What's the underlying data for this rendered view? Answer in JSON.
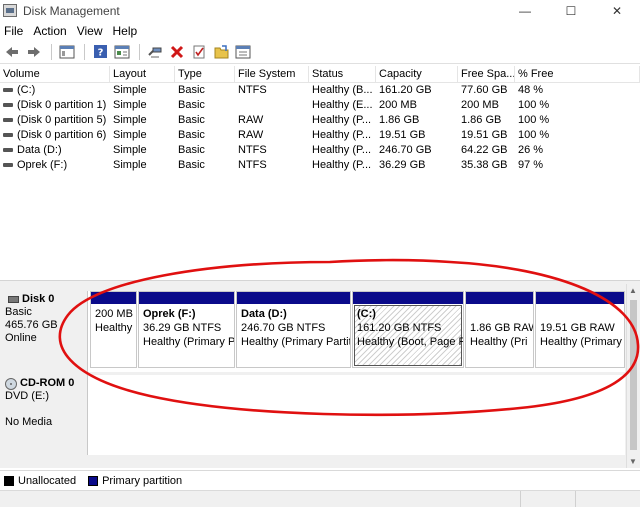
{
  "window": {
    "title": "Disk Management",
    "minimize": "—",
    "maximize": "☐",
    "close": "✕"
  },
  "menu": [
    "File",
    "Action",
    "View",
    "Help"
  ],
  "toolbar": {
    "icons": [
      "back-icon",
      "forward-icon",
      "console-tree-icon",
      "help-icon",
      "properties-icon",
      "connect-icon",
      "delete-icon",
      "check-icon",
      "folder-icon",
      "shortcut-icon"
    ]
  },
  "volume_list": {
    "columns": [
      "Volume",
      "Layout",
      "Type",
      "File System",
      "Status",
      "Capacity",
      "Free Spa...",
      "% Free"
    ],
    "rows": [
      {
        "volume": "(C:)",
        "layout": "Simple",
        "type": "Basic",
        "fs": "NTFS",
        "status": "Healthy (B...",
        "capacity": "161.20 GB",
        "free": "77.60 GB",
        "pct": "48 %"
      },
      {
        "volume": "(Disk 0 partition 1)",
        "layout": "Simple",
        "type": "Basic",
        "fs": "",
        "status": "Healthy (E...",
        "capacity": "200 MB",
        "free": "200 MB",
        "pct": "100 %"
      },
      {
        "volume": "(Disk 0 partition 5)",
        "layout": "Simple",
        "type": "Basic",
        "fs": "RAW",
        "status": "Healthy (P...",
        "capacity": "1.86 GB",
        "free": "1.86 GB",
        "pct": "100 %"
      },
      {
        "volume": "(Disk 0 partition 6)",
        "layout": "Simple",
        "type": "Basic",
        "fs": "RAW",
        "status": "Healthy (P...",
        "capacity": "19.51 GB",
        "free": "19.51 GB",
        "pct": "100 %"
      },
      {
        "volume": "Data (D:)",
        "layout": "Simple",
        "type": "Basic",
        "fs": "NTFS",
        "status": "Healthy (P...",
        "capacity": "246.70 GB",
        "free": "64.22 GB",
        "pct": "26 %"
      },
      {
        "volume": "Oprek (F:)",
        "layout": "Simple",
        "type": "Basic",
        "fs": "NTFS",
        "status": "Healthy (P...",
        "capacity": "36.29 GB",
        "free": "35.38 GB",
        "pct": "97 %"
      }
    ]
  },
  "disk0": {
    "name": "Disk 0",
    "type": "Basic",
    "size": "465.76 GB",
    "state": "Online",
    "partitions": [
      {
        "title": "",
        "line1": "200 MB",
        "line2": "Healthy"
      },
      {
        "title": "Oprek  (F:)",
        "line1": "36.29 GB NTFS",
        "line2": "Healthy (Primary P"
      },
      {
        "title": "Data  (D:)",
        "line1": "246.70 GB NTFS",
        "line2": "Healthy (Primary Partit"
      },
      {
        "title": "(C:)",
        "line1": "161.20 GB NTFS",
        "line2": "Healthy (Boot, Page F"
      },
      {
        "title": "",
        "line1": "1.86 GB RAW",
        "line2": "Healthy (Pri"
      },
      {
        "title": "",
        "line1": "19.51 GB RAW",
        "line2": "Healthy (Primary I"
      }
    ]
  },
  "cdrom0": {
    "name": "CD-ROM 0",
    "type": "DVD (E:)",
    "state": "No Media"
  },
  "legend": {
    "unallocated": "Unallocated",
    "primary": "Primary partition",
    "unallocated_color": "#000000",
    "primary_color": "#0a0a8a"
  },
  "annotation_color": "#e01010"
}
